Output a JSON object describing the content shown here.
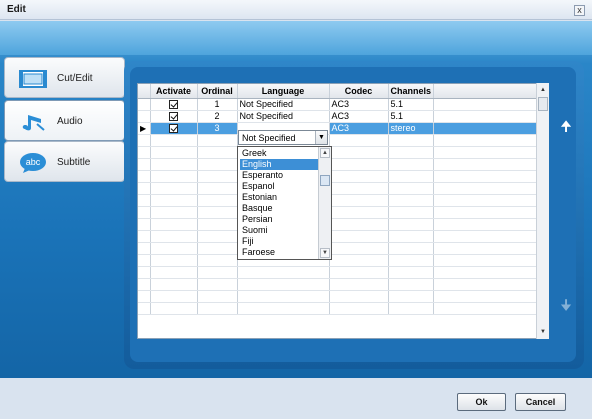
{
  "window": {
    "title": "Edit",
    "close_glyph": "x"
  },
  "tabs": [
    {
      "label": "Cut/Edit",
      "icon": "film-icon",
      "active": false
    },
    {
      "label": "Audio",
      "icon": "music-note-icon",
      "active": true
    },
    {
      "label": "Subtitle",
      "icon": "abc-bubble-icon",
      "active": false
    }
  ],
  "grid": {
    "columns": [
      "Activate",
      "Ordinal",
      "Language",
      "Codec",
      "Channels"
    ],
    "rows": [
      {
        "activate": true,
        "ordinal": "1",
        "language": "Not Specified",
        "codec": "AC3",
        "channels": "5.1"
      },
      {
        "activate": true,
        "ordinal": "2",
        "language": "Not Specified",
        "codec": "AC3",
        "channels": "5.1"
      },
      {
        "activate": true,
        "ordinal": "3",
        "language": "Not Specified",
        "codec": "AC3",
        "channels": "stereo",
        "selected": true
      }
    ]
  },
  "language_dropdown": {
    "current_value": "Not Specified",
    "highlighted": "English",
    "options": [
      "Greek",
      "English",
      "Esperanto",
      "Espanol",
      "Estonian",
      "Basque",
      "Persian",
      "Suomi",
      "Fiji",
      "Faroese"
    ]
  },
  "buttons": {
    "ok": "Ok",
    "cancel": "Cancel"
  },
  "colors": {
    "accent": "#1e70b5",
    "selection": "#4b9ee0",
    "highlight": "#3d8fd6"
  }
}
